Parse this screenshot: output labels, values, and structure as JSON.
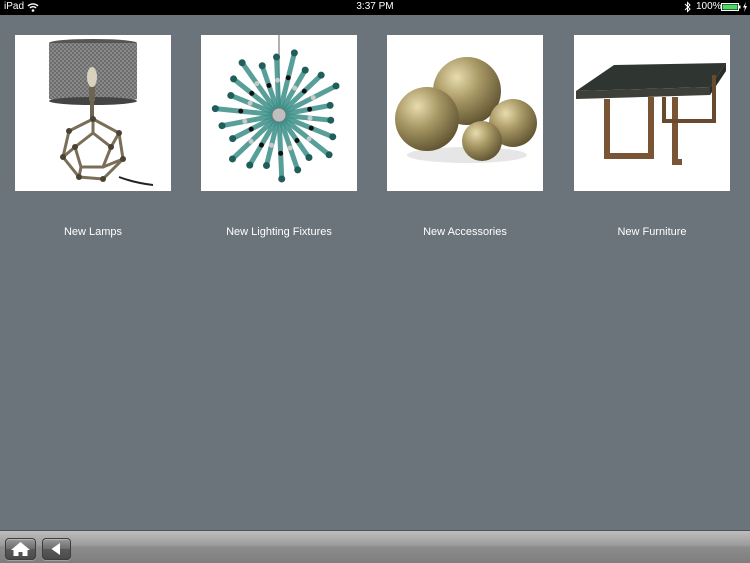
{
  "status_bar": {
    "carrier": "iPad",
    "time": "3:37 PM",
    "battery": "100%",
    "icons": [
      "wifi-icon",
      "bluetooth-icon",
      "battery-icon",
      "charging-icon"
    ]
  },
  "categories": [
    {
      "label": "New Lamps",
      "icon": "lamp-image"
    },
    {
      "label": "New Lighting Fixtures",
      "icon": "chandelier-image"
    },
    {
      "label": "New Accessories",
      "icon": "decorative-spheres-image"
    },
    {
      "label": "New Furniture",
      "icon": "table-image"
    }
  ],
  "toolbar": {
    "buttons": [
      {
        "icon": "home-icon"
      },
      {
        "icon": "back-arrow-icon"
      }
    ]
  },
  "colors": {
    "background": "#6b737b",
    "status_bar": "#000000",
    "battery_fill": "#4cd964",
    "caption_text": "#ffffff"
  }
}
